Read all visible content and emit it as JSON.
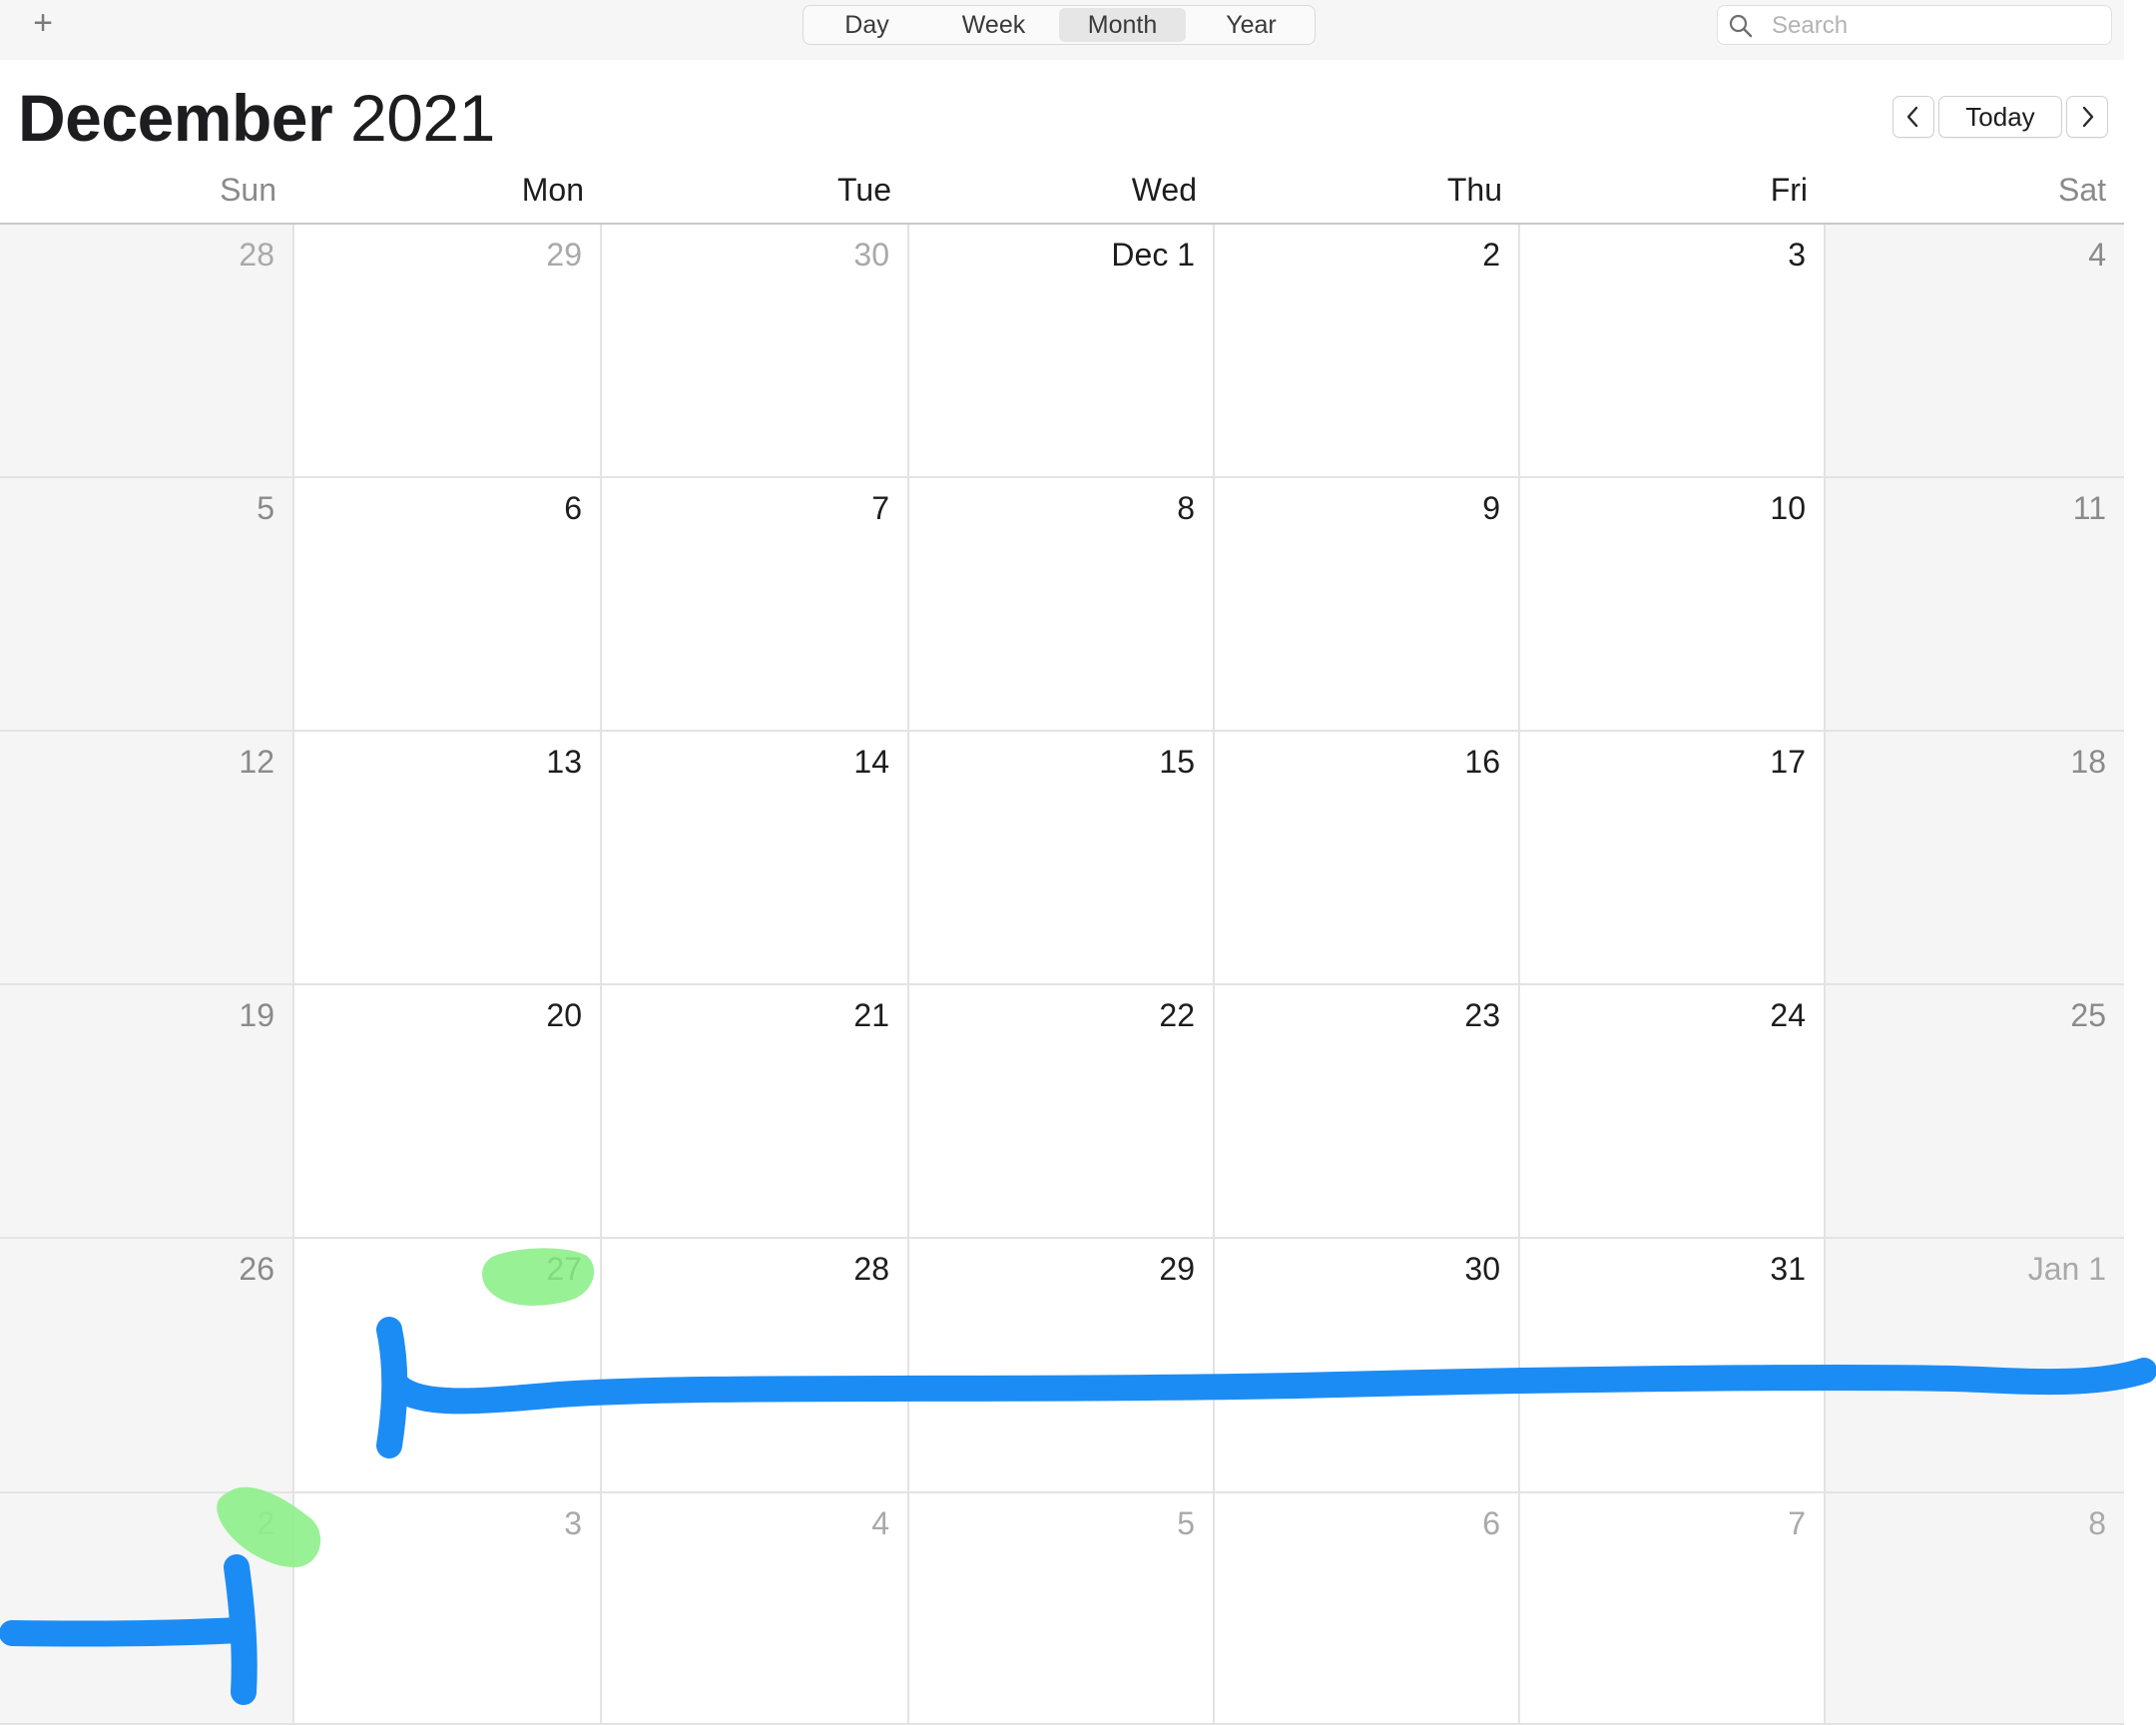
{
  "toolbar": {
    "add_icon": "plus-icon",
    "views": [
      "Day",
      "Week",
      "Month",
      "Year"
    ],
    "active_view": "Month",
    "search": {
      "placeholder": "Search",
      "value": ""
    }
  },
  "header": {
    "month": "December",
    "year": "2021",
    "today_label": "Today",
    "prev_icon": "chevron-left-icon",
    "next_icon": "chevron-right-icon"
  },
  "weekdays": [
    "Sun",
    "Mon",
    "Tue",
    "Wed",
    "Thu",
    "Fri",
    "Sat"
  ],
  "weeks": [
    [
      {
        "label": "28",
        "dim": true
      },
      {
        "label": "29",
        "dim": true
      },
      {
        "label": "30",
        "dim": true
      },
      {
        "label": "Dec 1"
      },
      {
        "label": "2"
      },
      {
        "label": "3"
      },
      {
        "label": "4"
      }
    ],
    [
      {
        "label": "5"
      },
      {
        "label": "6"
      },
      {
        "label": "7"
      },
      {
        "label": "8"
      },
      {
        "label": "9"
      },
      {
        "label": "10"
      },
      {
        "label": "11"
      }
    ],
    [
      {
        "label": "12"
      },
      {
        "label": "13"
      },
      {
        "label": "14"
      },
      {
        "label": "15"
      },
      {
        "label": "16"
      },
      {
        "label": "17"
      },
      {
        "label": "18"
      }
    ],
    [
      {
        "label": "19"
      },
      {
        "label": "20"
      },
      {
        "label": "21"
      },
      {
        "label": "22"
      },
      {
        "label": "23"
      },
      {
        "label": "24"
      },
      {
        "label": "25"
      }
    ],
    [
      {
        "label": "26"
      },
      {
        "label": "27"
      },
      {
        "label": "28"
      },
      {
        "label": "29"
      },
      {
        "label": "30"
      },
      {
        "label": "31"
      },
      {
        "label": "Jan 1",
        "dim": true
      }
    ],
    [
      {
        "label": "2",
        "dim": true
      },
      {
        "label": "3",
        "dim": true
      },
      {
        "label": "4",
        "dim": true
      },
      {
        "label": "5",
        "dim": true
      },
      {
        "label": "6",
        "dim": true
      },
      {
        "label": "7",
        "dim": true
      },
      {
        "label": "8",
        "dim": true
      }
    ]
  ],
  "annotations": {
    "highlight_color": "#8ef08a",
    "stroke_color": "#1c8cf5"
  }
}
